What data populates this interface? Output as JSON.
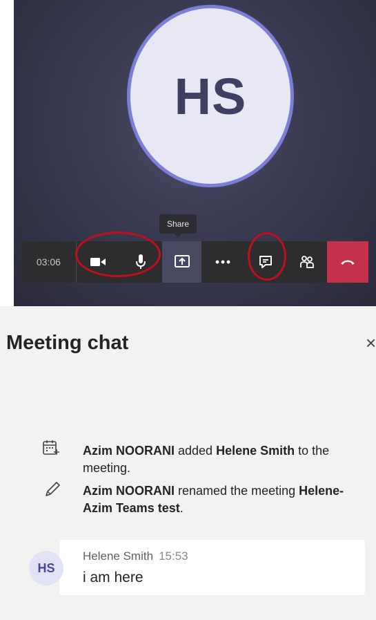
{
  "call": {
    "avatar_initials": "HS",
    "timer": "03:06",
    "share_tooltip": "Share",
    "toolbar": {
      "camera_icon": "camera-icon",
      "mic_icon": "microphone-icon",
      "share_icon": "share-screen-icon",
      "more_icon": "more-options-icon",
      "chat_icon": "chat-icon",
      "participants_icon": "participants-icon",
      "hangup_icon": "hang-up-icon"
    },
    "colors": {
      "end_call": "#c4314b",
      "avatar_ring": "#7b7fd8",
      "annotation_circle": "#c0101c"
    }
  },
  "chat": {
    "title": "Meeting chat",
    "close_label": "×",
    "events": [
      {
        "icon": "calendar-add-icon",
        "actor": "Azim NOORANI",
        "action": " added ",
        "target": "Helene Smith",
        "suffix": " to the meeting."
      },
      {
        "icon": "pencil-icon",
        "actor": "Azim NOORANI",
        "action": " renamed the meeting ",
        "target": "Helene-Azim Teams test",
        "suffix": "."
      }
    ],
    "message": {
      "initials": "HS",
      "author": "Helene Smith",
      "time": "15:53",
      "text": "i am here"
    }
  }
}
